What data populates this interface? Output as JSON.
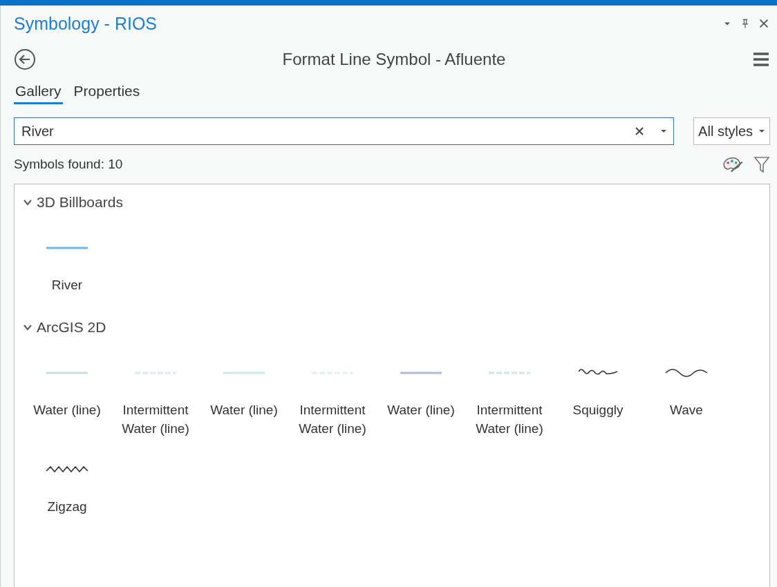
{
  "panel": {
    "title": "Symbology - RIOS"
  },
  "header": {
    "title": "Format Line Symbol - Afluente"
  },
  "tabs": [
    {
      "label": "Gallery",
      "selected": true
    },
    {
      "label": "Properties",
      "selected": false
    }
  ],
  "search": {
    "value": "River"
  },
  "style_filter": {
    "value": "All styles"
  },
  "status": "Symbols found: 10",
  "groups": [
    {
      "title": "3D Billboards",
      "expanded": true,
      "symbols": [
        {
          "label": "River",
          "kind": "solid",
          "color": "#6fb6ee"
        }
      ]
    },
    {
      "title": "ArcGIS 2D",
      "expanded": true,
      "symbols": [
        {
          "label": "Water (line)",
          "kind": "solid",
          "color": "#c5dbef"
        },
        {
          "label": "Intermittent Water (line)",
          "kind": "dashed",
          "color": "#dbe9f5"
        },
        {
          "label": "Water (line)",
          "kind": "solid",
          "color": "#c9e6f5"
        },
        {
          "label": "Intermittent Water (line)",
          "kind": "dashed",
          "color": "#e3eef7"
        },
        {
          "label": "Water (line)",
          "kind": "solid",
          "color": "#a9bedc"
        },
        {
          "label": "Intermittent Water (line)",
          "kind": "dashed",
          "color": "#d5e0ee"
        },
        {
          "label": "Squiggly",
          "kind": "squiggly",
          "color": "#333333"
        },
        {
          "label": "Wave",
          "kind": "wave",
          "color": "#333333"
        },
        {
          "label": "Zigzag",
          "kind": "zigzag",
          "color": "#333333"
        }
      ]
    }
  ]
}
